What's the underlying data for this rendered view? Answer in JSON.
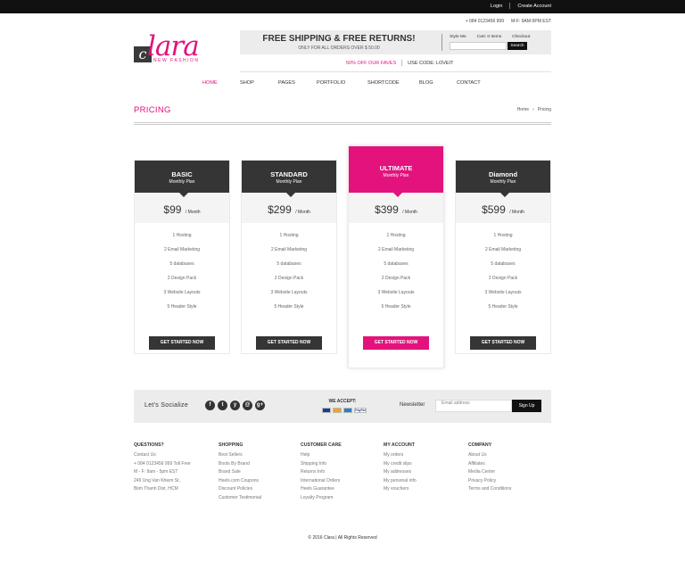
{
  "topbar": {
    "login": "Login",
    "create_account": "Create Account"
  },
  "contact": {
    "phone": "+ 084 0123456 999",
    "hours": "M-F: 9AM-5PM EST"
  },
  "logo": {
    "letter": "c",
    "script": "lara",
    "tagline": "NEW FASHION"
  },
  "promo": {
    "headline": "FREE SHIPPING & FREE RETURNS!",
    "sub": "ONLY FOR ALL ORDERS OVER $ 50.00",
    "style_me": "Style Me",
    "cart": "Cart: 0 Items",
    "checkout": "Checkout",
    "search_button": "Search"
  },
  "offer": {
    "text": "50% OFF OUR FAVES",
    "code": "USE CODE: LOVEIT"
  },
  "nav": [
    "HOME",
    "SHOP",
    "PAGES",
    "PORTFOLIO",
    "SHORTCODE",
    "BLOG",
    "CONTACT"
  ],
  "page": {
    "title": "PRICING",
    "crumb_home": "Home",
    "crumb_sep": "›",
    "crumb_current": "Pricing"
  },
  "plans": [
    {
      "name": "BASIC",
      "sub": "Monthly Plan",
      "price": "$99",
      "per": "/ Month",
      "button": "GET STARTED NOW"
    },
    {
      "name": "STANDARD",
      "sub": "Monthly Plan",
      "price": "$299",
      "per": "/ Month",
      "button": "GET STARTED NOW"
    },
    {
      "name": "ULTIMATE",
      "sub": "Monthly Plan",
      "price": "$399",
      "per": "/ Month",
      "button": "GET STARTED NOW"
    },
    {
      "name": "Diamond",
      "sub": "Monthly Plan",
      "price": "$599",
      "per": "/ Month",
      "button": "GET STARTED NOW"
    }
  ],
  "features": [
    "1 Hosting",
    "2 Email Marketing",
    "5 databases",
    "2 Design Pack",
    "3 Website Layouts",
    "5 Header Style"
  ],
  "social": {
    "lets": "Let's Socialize",
    "icons": [
      "f",
      "t",
      "y",
      "@",
      "g+"
    ],
    "we_accept": "WE ACCEPT:",
    "paypal": "PayPal",
    "newsletter": "Newsletter",
    "email_placeholder": "Email address",
    "signup": "Sign Up"
  },
  "footer": {
    "questions": {
      "title": "QUESTIONS?",
      "lines": [
        "Contact Us",
        "+ 084 0123456 999 Toll Free",
        "M - F: 9am - 5pm EST",
        "249 Ung Van Khiem St,",
        "Binh Thanh Dist, HCM"
      ]
    },
    "shopping": {
      "title": "SHOPPING",
      "lines": [
        "Best Sellers",
        "Boots By Brand",
        "Brand Sale",
        "Heels.com Coupons",
        "Discount Policies",
        "Customer Testimonial"
      ]
    },
    "care": {
      "title": "CUSTOMER CARE",
      "lines": [
        "Help",
        "Shipping Info",
        "Returns Info",
        "International Orders",
        "Heels Guarantee",
        "Loyalty Program"
      ]
    },
    "account": {
      "title": "MY ACCOUNT",
      "lines": [
        "My orders",
        "My credit slips",
        "My addresses",
        "My personal info",
        "My vouchers"
      ]
    },
    "company": {
      "title": "COMPANY",
      "lines": [
        "About Us",
        "Affiliates",
        "Media Center",
        "Privacy Policy",
        "Terms and Conditions"
      ]
    }
  },
  "copyright": "© 2016 Clara  |  All Rights Reserved"
}
